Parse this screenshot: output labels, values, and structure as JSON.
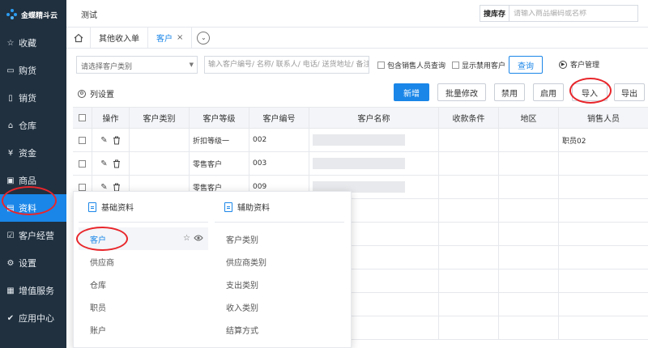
{
  "brand": {
    "name": "金蝶精斗云"
  },
  "sidebar": {
    "items": [
      {
        "icon": "star-icon",
        "glyph": "☆",
        "label": "收藏"
      },
      {
        "icon": "cart-icon",
        "glyph": "▭",
        "label": "购货"
      },
      {
        "icon": "sales-icon",
        "glyph": "▯",
        "label": "销货"
      },
      {
        "icon": "warehouse-icon",
        "glyph": "⌂",
        "label": "仓库"
      },
      {
        "icon": "money-icon",
        "glyph": "¥",
        "label": "资金"
      },
      {
        "icon": "goods-icon",
        "glyph": "▣",
        "label": "商品"
      },
      {
        "icon": "data-icon",
        "glyph": "▤",
        "label": "资料"
      },
      {
        "icon": "customer-icon",
        "glyph": "☑",
        "label": "客户经营"
      },
      {
        "icon": "settings-icon",
        "glyph": "⚙",
        "label": "设置"
      },
      {
        "icon": "value-icon",
        "glyph": "▦",
        "label": "增值服务"
      },
      {
        "icon": "apps-icon",
        "glyph": "✔",
        "label": "应用中心"
      }
    ],
    "active_index": 6
  },
  "topbar": {
    "app_title": "测试",
    "search_scope": "搜库存",
    "search_placeholder": "请输入商品编码或名称"
  },
  "tabs": {
    "items": [
      {
        "label": "其他收入单"
      },
      {
        "label": "客户",
        "close": "×"
      }
    ],
    "more_glyph": "⌄"
  },
  "filters": {
    "category_placeholder": "请选择客户类别",
    "keyword_placeholder": "输入客户编号/ 名称/ 联系人/ 电话/ 送货地址/ 备注信息",
    "include_sales_label": "包含销售人员查询",
    "show_disabled_label": "显示禁用客户",
    "query_label": "查询",
    "customer_mgmt_label": "客户管理"
  },
  "toolbar": {
    "column_settings": "列设置",
    "add": "新增",
    "batch_edit": "批量修改",
    "disable": "禁用",
    "enable": "启用",
    "import": "导入",
    "export": "导出"
  },
  "table": {
    "headers": [
      "操作",
      "客户类别",
      "客户等级",
      "客户编号",
      "客户名称",
      "收款条件",
      "地区",
      "销售人员"
    ],
    "rows": [
      {
        "category": "",
        "level": "折扣等级一",
        "code": "002",
        "terms": "",
        "area": "",
        "sales": "职员02"
      },
      {
        "category": "",
        "level": "零售客户",
        "code": "003",
        "terms": "",
        "area": "",
        "sales": ""
      },
      {
        "category": "",
        "level": "零售客户",
        "code": "009",
        "terms": "",
        "area": "",
        "sales": ""
      }
    ]
  },
  "menu": {
    "basic_title": "基础资料",
    "aux_title": "辅助资料",
    "basic_items": [
      "客户",
      "供应商",
      "仓库",
      "职员",
      "账户"
    ],
    "aux_items": [
      "客户类别",
      "供应商类别",
      "支出类别",
      "收入类别",
      "结算方式"
    ]
  },
  "colors": {
    "accent": "#1a86e8",
    "sidebar_bg": "#20303f",
    "highlight_ring": "#e8262b"
  }
}
